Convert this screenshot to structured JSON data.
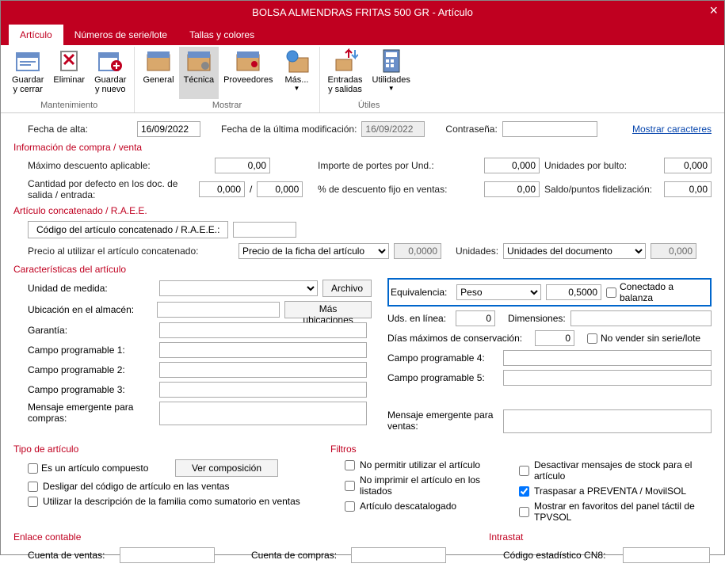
{
  "window": {
    "title": "BOLSA ALMENDRAS FRITAS 500 GR - Artículo"
  },
  "tabs": [
    "Artículo",
    "Números de serie/lote",
    "Tallas y colores"
  ],
  "ribbon": {
    "groups": [
      {
        "label": "Mantenimiento",
        "buttons": [
          {
            "id": "save-close",
            "label": "Guardar\ny cerrar"
          },
          {
            "id": "delete",
            "label": "Eliminar"
          },
          {
            "id": "save-new",
            "label": "Guardar\ny nuevo"
          }
        ]
      },
      {
        "label": "Mostrar",
        "buttons": [
          {
            "id": "general",
            "label": "General"
          },
          {
            "id": "tecnica",
            "label": "Técnica",
            "active": true
          },
          {
            "id": "proveedores",
            "label": "Proveedores"
          },
          {
            "id": "mas",
            "label": "Más..."
          }
        ]
      },
      {
        "label": "Útiles",
        "buttons": [
          {
            "id": "entradas",
            "label": "Entradas\ny salidas"
          },
          {
            "id": "utilidades",
            "label": "Utilidades"
          }
        ]
      }
    ]
  },
  "header": {
    "fecha_alta_label": "Fecha de alta:",
    "fecha_alta": "16/09/2022",
    "fecha_mod_label": "Fecha de la última modificación:",
    "fecha_mod": "16/09/2022",
    "contrasena_label": "Contraseña:",
    "contrasena": "",
    "mostrar_caracteres": "Mostrar caracteres"
  },
  "compra_venta": {
    "title": "Información de compra / venta",
    "max_desc_label": "Máximo descuento aplicable:",
    "max_desc": "0,00",
    "cant_defecto_label": "Cantidad por defecto en los doc. de salida / entrada:",
    "cant_salida": "0,000",
    "cant_entrada": "0,000",
    "importe_portes_label": "Importe de portes por Und.:",
    "importe_portes": "0,000",
    "pct_desc_label": "% de descuento fijo en ventas:",
    "pct_desc": "0,00",
    "uds_bulto_label": "Unidades por bulto:",
    "uds_bulto": "0,000",
    "saldo_label": "Saldo/puntos fidelización:",
    "saldo": "0,00"
  },
  "concatenado": {
    "title": "Artículo concatenado / R.A.E.E.",
    "codigo_label": "Código del artículo concatenado / R.A.E.E.:",
    "codigo": "",
    "precio_label": "Precio al utilizar el artículo concatenado:",
    "precio_sel": "Precio de la ficha del artículo",
    "precio_val": "0,0000",
    "unidades_label": "Unidades:",
    "unidades_sel": "Unidades del documento",
    "unidades_val": "0,000"
  },
  "caracteristicas": {
    "title": "Características del artículo",
    "unidad_medida_label": "Unidad de medida:",
    "unidad_medida": "",
    "archivo_btn": "Archivo",
    "equivalencia_label": "Equivalencia:",
    "equivalencia_sel": "Peso",
    "equivalencia_val": "0,5000",
    "conectado_label": "Conectado a balanza",
    "ubicacion_label": "Ubicación en el almacén:",
    "ubicacion": "",
    "mas_ubicaciones_btn": "Más ubicaciones",
    "uds_linea_label": "Uds. en línea:",
    "uds_linea": "0",
    "dimensiones_label": "Dimensiones:",
    "dimensiones": "",
    "garantia_label": "Garantía:",
    "garantia": "",
    "dias_max_label": "Días máximos de conservación:",
    "dias_max": "0",
    "no_vender_label": "No vender sin serie/lote",
    "campo1_label": "Campo programable 1:",
    "campo2_label": "Campo programable 2:",
    "campo3_label": "Campo programable 3:",
    "campo4_label": "Campo programable 4:",
    "campo5_label": "Campo programable 5:",
    "campo1": "",
    "campo2": "",
    "campo3": "",
    "campo4": "",
    "campo5": "",
    "msg_compras_label": "Mensaje emergente para compras:",
    "msg_compras": "",
    "msg_ventas_label": "Mensaje emergente para ventas:",
    "msg_ventas": ""
  },
  "tipo": {
    "title": "Tipo de artículo",
    "compuesto": "Es un artículo compuesto",
    "ver_comp_btn": "Ver composición",
    "desligar": "Desligar del código de artículo en las ventas",
    "utilizar_desc": "Utilizar la descripción de la familia como sumatorio en ventas"
  },
  "filtros": {
    "title": "Filtros",
    "no_permitir": "No permitir utilizar el artículo",
    "no_imprimir": "No imprimir el artículo en los listados",
    "descatalogado": "Artículo descatalogado",
    "desactivar_stock": "Desactivar mensajes de stock para el artículo",
    "traspasar": "Traspasar a PREVENTA / MovilSOL",
    "favoritos": "Mostrar en favoritos del panel táctil de TPVSOL"
  },
  "enlace": {
    "title": "Enlace contable",
    "cta_ventas_label": "Cuenta de ventas:",
    "cta_ventas": "",
    "cta_compras_label": "Cuenta de compras:",
    "cta_compras": ""
  },
  "intrastat": {
    "title": "Intrastat",
    "cn8_label": "Código estadístico CN8:",
    "cn8": ""
  }
}
